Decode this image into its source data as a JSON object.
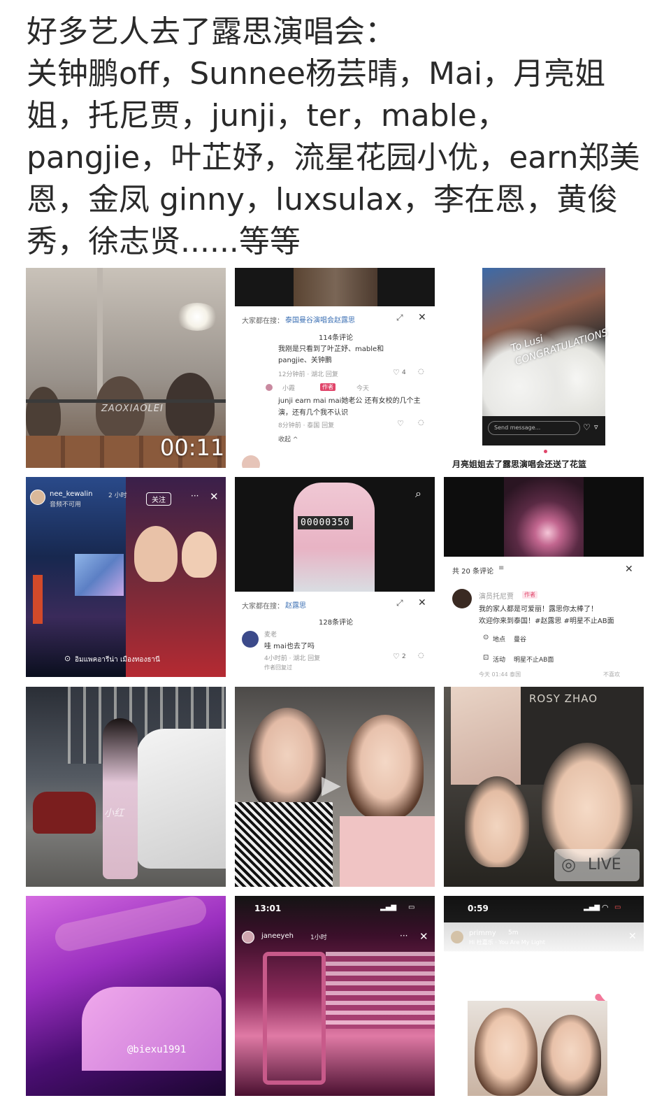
{
  "post": {
    "text": "好多艺人去了露思演唱会：\n关钟鹏off，Sunnee杨芸晴，Mai，月亮姐姐，托尼贾，junji，ter，mable，pangjie，叶芷妤，流星花园小优，earn郑美恩，金凤 ginny，luxsulax，李在恩，黄俊秀，徐志贤......等等"
  },
  "tiles": {
    "t1": {
      "watermark": "ZAOXIAOLEI",
      "duration": "00:11"
    },
    "t2": {
      "search_prefix": "大家都在搜：",
      "search_term": "泰国曼谷演唱会赵露思",
      "comment_count": "114条评论",
      "c1_text": "我刚是只看到了叶芷妤、mable和pangjie、关钟鹏",
      "c1_meta": "12分钟前 · 湖北   回复",
      "c1_likes": "4",
      "c2_user": "小霞",
      "c2_badge": "作者",
      "c2_time": "今天",
      "c2_text": "junji earn mai mai她老公 还有女校的几个主演，还有几个我不认识",
      "c2_meta": "8分钟前 · 泰国   回复",
      "collapse": "收起 ^"
    },
    "t3": {
      "card_text": "To Lusi CONGRATULATIONS",
      "send_placeholder": "Send message...",
      "caption": "月亮姐姐去了露思演唱会还送了花篮"
    },
    "t4": {
      "user": "nee_kewalin",
      "time": "2 小时",
      "sub": "音频不可用",
      "follow": "关注",
      "location": "อิมแพคอารีน่า เมืองทองธานี"
    },
    "t5": {
      "counter": "00000350",
      "search_prefix": "大家都在搜：",
      "search_term": "赵露思",
      "comment_count": "128条评论",
      "c1_user": "麦老",
      "c1_text": "哇 mai也去了吗",
      "c1_meta": "4小时前 · 湖北   回复",
      "c1_likes": "2",
      "c1_sub": "作者回复过"
    },
    "t6": {
      "comment_header": "共 20 条评论",
      "user": "演员托尼贾",
      "badge": "作者",
      "text1": "我的家人都是可爱丽！露思你太棒了！",
      "text2": "欢迎你来到泰国！#赵露思 #明星不止AB面",
      "location_label": "地点",
      "location_value": "曼谷",
      "activity_label": "活动",
      "activity_value": "明星不止AB面",
      "footer_left": "今天 01:44 泰国",
      "footer_right": "不喜欢"
    },
    "t7": {
      "watermark": "小红"
    },
    "t9": {
      "poster_text": "ROSY ZHAO",
      "live": "LIVE"
    },
    "t10": {
      "handle": "@biexu1991"
    },
    "t11": {
      "time": "13:01",
      "user": "janeeyeh",
      "ago": "1小时"
    },
    "t12": {
      "time": "0:59",
      "user": "primmy",
      "ago": "5m",
      "sub": "Hi 杜嘉乐 · You Are My Light"
    }
  }
}
